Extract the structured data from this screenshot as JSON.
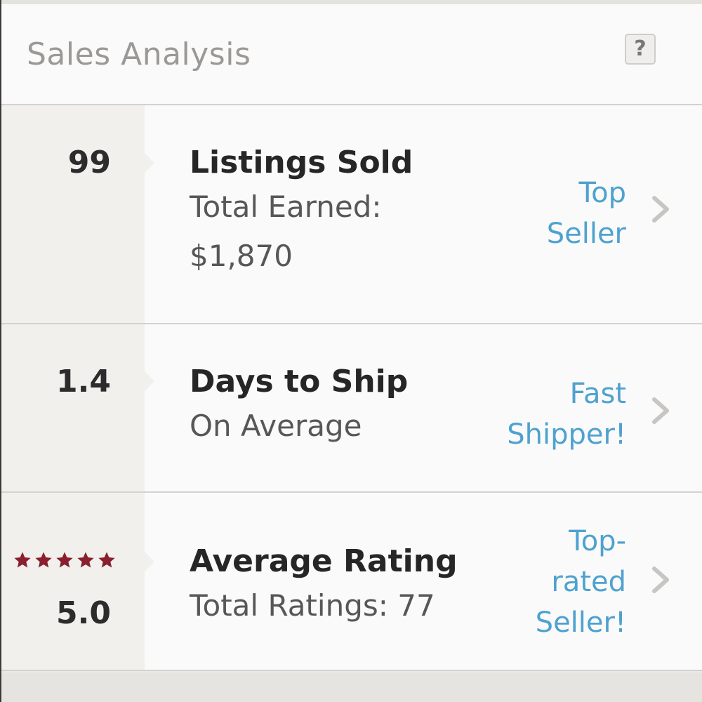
{
  "header": {
    "title": "Sales Analysis",
    "help_label": "?"
  },
  "colors": {
    "link": "#4ea2cf",
    "star": "#8a1f2e",
    "chevron": "#c8c6c3"
  },
  "rows": [
    {
      "metric": "99",
      "title": "Listings Sold",
      "subtitle_lines": [
        "Total Earned:",
        "$1,870"
      ],
      "badge_lines": [
        "Top",
        "Seller"
      ],
      "icon": "chevron-right-icon"
    },
    {
      "metric": "1.4",
      "title": "Days to Ship",
      "subtitle_lines": [
        "On Average"
      ],
      "badge_lines": [
        "Fast",
        "Shipper!"
      ],
      "icon": "chevron-right-icon"
    },
    {
      "metric": "5.0",
      "stars": 5,
      "title": "Average Rating",
      "subtitle_lines": [
        "Total Ratings: 77"
      ],
      "badge_lines": [
        "Top-",
        "rated",
        "Seller!"
      ],
      "icon": "chevron-right-icon"
    }
  ]
}
